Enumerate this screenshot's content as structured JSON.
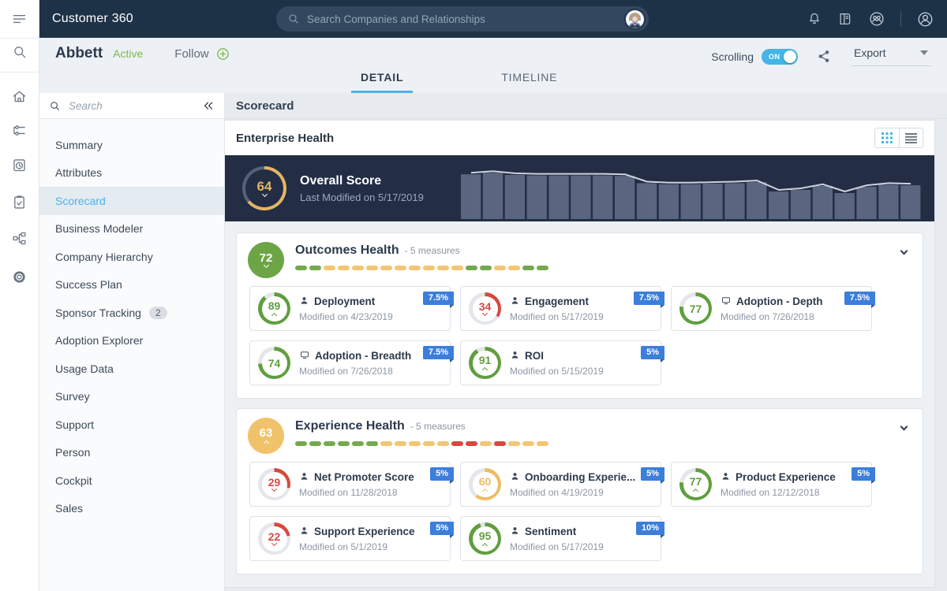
{
  "colors": {
    "accent_blue": "#4cb4ea",
    "ribbon_blue": "#3b7edb",
    "navbar_bg": "#1e3247",
    "banner_bg": "#232e45",
    "bar_color": "#5a6680",
    "line_color": "#ccd2dd",
    "ring_amber": "#e4b662",
    "ring_rest": "#57617a",
    "donut_rest": "#e3e6ea",
    "tiers": {
      "green": "#609e3f",
      "red": "#d6493f",
      "amber": "#edbd62"
    },
    "circle_tiers": {
      "green": "#6da546",
      "amber": "#f0c36b"
    },
    "dash": {
      "green": "#76a94e",
      "yellow": "#f2c672",
      "red": "#d6493f"
    }
  },
  "rail": {
    "icons": [
      "hamburger",
      "search",
      "home",
      "relationships",
      "timer",
      "tasks",
      "hierarchy",
      "settings"
    ]
  },
  "navbar": {
    "title": "Customer 360",
    "search_placeholder": "Search Companies and Relationships",
    "icons": [
      "bell",
      "book",
      "community",
      "avatar"
    ]
  },
  "header": {
    "company": "Abbett",
    "status": "Active",
    "follow": "Follow",
    "scrolling_label": "Scrolling",
    "toggle": "ON",
    "export": "Export"
  },
  "tabs": [
    {
      "label": "DETAIL",
      "active": true
    },
    {
      "label": "TIMELINE",
      "active": false
    }
  ],
  "sidebar": {
    "search_placeholder": "Search",
    "items": [
      {
        "label": "Summary"
      },
      {
        "label": "Attributes"
      },
      {
        "label": "Scorecard",
        "selected": true
      },
      {
        "label": "Business Modeler"
      },
      {
        "label": "Company Hierarchy"
      },
      {
        "label": "Success Plan"
      },
      {
        "label": "Sponsor Tracking",
        "badge": "2"
      },
      {
        "label": "Adoption Explorer"
      },
      {
        "label": "Usage Data"
      },
      {
        "label": "Survey"
      },
      {
        "label": "Support"
      },
      {
        "label": "Person"
      },
      {
        "label": "Cockpit"
      },
      {
        "label": "Sales"
      }
    ]
  },
  "main": {
    "title": "Scorecard",
    "panel_title": "Enterprise Health"
  },
  "overall": {
    "score": 64,
    "trend": "down",
    "label": "Overall Score",
    "sublabel": "Last Modified on 5/17/2019"
  },
  "chart_data": {
    "type": "bar",
    "title": "Overall Score history sparkline",
    "values": [
      86,
      89,
      85,
      84,
      84,
      84,
      84,
      83,
      69,
      67,
      67,
      68,
      69,
      71,
      53,
      56,
      64,
      50,
      62,
      66,
      65
    ],
    "ylim": [
      0,
      100
    ],
    "overlay_line": true,
    "axes_visible": false,
    "legend": false
  },
  "sections": [
    {
      "score": 72,
      "tier": "green",
      "trend": "down",
      "title": "Outcomes Health",
      "measures": "- 5 measures",
      "dashes": [
        "green",
        "green",
        "yellow",
        "yellow",
        "yellow",
        "yellow",
        "yellow",
        "yellow",
        "yellow",
        "yellow",
        "yellow",
        "yellow",
        "green",
        "green",
        "yellow",
        "yellow",
        "green",
        "green"
      ],
      "cards": [
        {
          "score": 89,
          "tier": "green",
          "trend": "up",
          "icon": "user",
          "title": "Deployment",
          "modified": "Modified on 4/23/2019",
          "weight": "7.5%"
        },
        {
          "score": 34,
          "tier": "red",
          "trend": "down",
          "icon": "user",
          "title": "Engagement",
          "modified": "Modified on 5/17/2019",
          "weight": "7.5%"
        },
        {
          "score": 77,
          "tier": "green",
          "trend": "none",
          "icon": "monitor",
          "title": "Adoption - Depth",
          "modified": "Modified on 7/26/2018",
          "weight": "7.5%"
        },
        {
          "score": 74,
          "tier": "green",
          "trend": "none",
          "icon": "monitor",
          "title": "Adoption - Breadth",
          "modified": "Modified on 7/26/2018",
          "weight": "7.5%"
        },
        {
          "score": 91,
          "tier": "green",
          "trend": "up",
          "icon": "user",
          "title": "ROI",
          "modified": "Modified on 5/15/2019",
          "weight": "5%"
        }
      ]
    },
    {
      "score": 63,
      "tier": "amber",
      "trend": "up",
      "title": "Experience Health",
      "measures": "- 5 measures",
      "dashes": [
        "green",
        "green",
        "green",
        "green",
        "green",
        "green",
        "yellow",
        "yellow",
        "yellow",
        "yellow",
        "yellow",
        "red",
        "red",
        "yellow",
        "red",
        "yellow",
        "yellow",
        "yellow"
      ],
      "cards": [
        {
          "score": 29,
          "tier": "red",
          "trend": "down",
          "icon": "user",
          "title": "Net Promoter Score",
          "modified": "Modified on 11/28/2018",
          "weight": "5%"
        },
        {
          "score": 60,
          "tier": "amber",
          "trend": "up",
          "icon": "user",
          "title": "Onboarding Experie...",
          "modified": "Modified on 4/19/2019",
          "weight": "5%"
        },
        {
          "score": 77,
          "tier": "green",
          "trend": "up",
          "icon": "user",
          "title": "Product Experience",
          "modified": "Modified on 12/12/2018",
          "weight": "5%"
        },
        {
          "score": 22,
          "tier": "red",
          "trend": "down",
          "icon": "user",
          "title": "Support Experience",
          "modified": "Modified on 5/1/2019",
          "weight": "5%"
        },
        {
          "score": 95,
          "tier": "green",
          "trend": "up",
          "icon": "user",
          "title": "Sentiment",
          "modified": "Modified on 5/17/2019",
          "weight": "10%"
        }
      ]
    }
  ]
}
